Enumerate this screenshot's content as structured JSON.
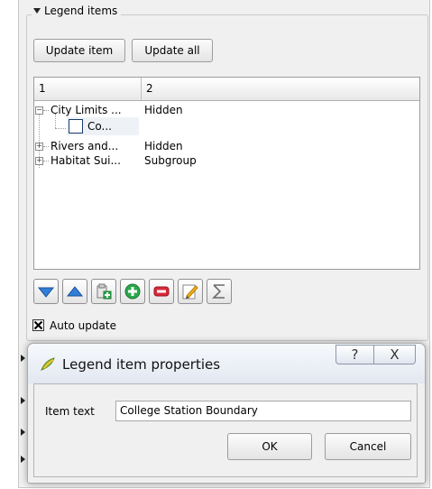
{
  "legend_panel": {
    "group_title": "Legend items",
    "update_item_label": "Update item",
    "update_all_label": "Update all",
    "columns": [
      "1",
      "2"
    ],
    "rows": [
      {
        "col1": "City Limits ...",
        "col2": "Hidden"
      },
      {
        "col1": "Co...",
        "col2": ""
      },
      {
        "col1": "Rivers and...",
        "col2": "Hidden"
      },
      {
        "col1": "Habitat Sui...",
        "col2": "Subgroup"
      }
    ],
    "toolbar_icons": [
      "move-down-icon",
      "move-up-icon",
      "add-group-icon",
      "add-item-icon",
      "remove-item-icon",
      "edit-item-icon",
      "sigma-icon"
    ],
    "auto_update_label": "Auto update",
    "auto_update_checked": true
  },
  "dialog": {
    "title": "Legend item properties",
    "help_glyph": "?",
    "close_glyph": "X",
    "item_text_label": "Item text",
    "item_text_value": "College Station Boundary",
    "ok_label": "OK",
    "cancel_label": "Cancel"
  },
  "colors": {
    "accent_blue": "#2f7fd8",
    "add_green": "#2aa84a",
    "remove_red": "#d8283a"
  }
}
